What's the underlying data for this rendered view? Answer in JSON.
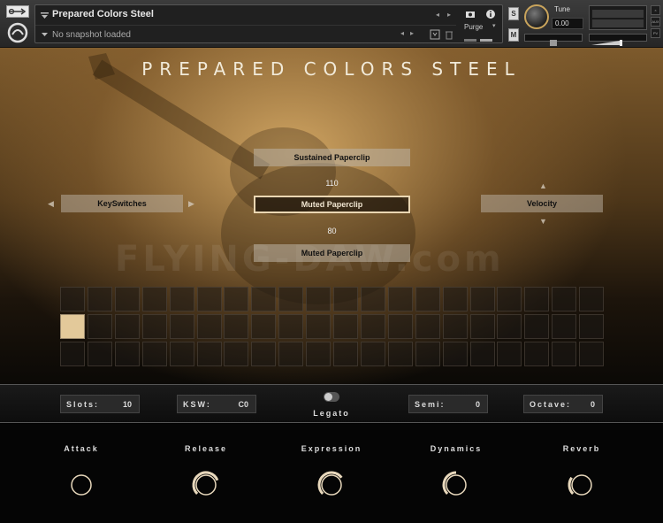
{
  "header": {
    "instrument_name": "Prepared Colors Steel",
    "snapshot": "No snapshot loaded",
    "purge_label": "Purge",
    "s_button": "S",
    "m_button": "M",
    "tune_label": "Tune",
    "tune_value": "0.00",
    "mini_labels": [
      "×",
      "AUX",
      "PV"
    ]
  },
  "title": "PREPARED COLORS STEEL",
  "watermark": "FLYING-DAW.com",
  "articulations": {
    "top": "Sustained Paperclip",
    "velocity_high": "110",
    "selected": "Muted Paperclip",
    "velocity_low": "80",
    "bottom": "Muted Paperclip"
  },
  "left_selector": "KeySwitches",
  "right_selector": "Velocity",
  "grid": {
    "rows": 3,
    "cols": 20,
    "active_row": 1,
    "active_col": 0
  },
  "strip": {
    "slots_label": "Slots:",
    "slots_value": "10",
    "ksw_label": "KSW:",
    "ksw_value": "C0",
    "legato_label": "Legato",
    "semi_label": "Semi:",
    "semi_value": "0",
    "octave_label": "Octave:",
    "octave_value": "0"
  },
  "knobs": [
    {
      "label": "Attack",
      "value": 0.0
    },
    {
      "label": "Release",
      "value": 0.75
    },
    {
      "label": "Expression",
      "value": 0.7
    },
    {
      "label": "Dynamics",
      "value": 0.5
    },
    {
      "label": "Reverb",
      "value": 0.3
    }
  ],
  "colors": {
    "accent": "#e3c99a",
    "knob_ring": "#e8d8bc",
    "tune_ring": "#c9a45c"
  }
}
